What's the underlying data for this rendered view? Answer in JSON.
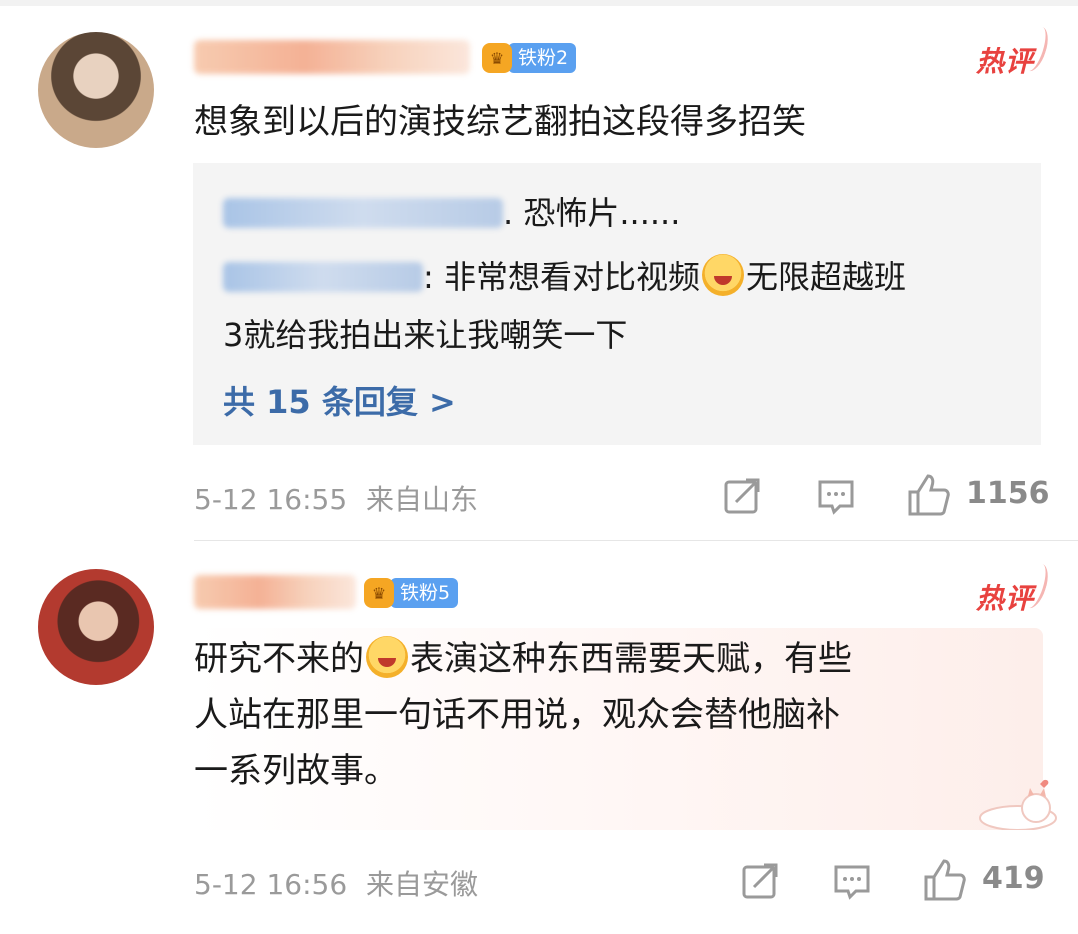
{
  "comments": [
    {
      "badge": "铁粉2",
      "hot_label": "热评",
      "text": "想象到以后的演技综艺翻拍这段得多招笑",
      "replies": [
        {
          "text": ". 恐怖片......"
        },
        {
          "text": ": 非常想看对比视频",
          "text2": "无限超越班",
          "text3": "3就给我拍出来让我嘲笑一下"
        }
      ],
      "more_replies": "共 15 条回复 >",
      "timestamp": "5-12 16:55",
      "location": "来自山东",
      "likes": "1156"
    },
    {
      "badge": "铁粉5",
      "hot_label": "热评",
      "text_line1a": "研究不来的",
      "text_line1b": "表演这种东西需要天赋，有些",
      "text_line2": "人站在那里一句话不用说，观众会替他脑补",
      "text_line3": "一系列故事。",
      "timestamp": "5-12 16:56",
      "location": "来自安徽",
      "likes": "419"
    }
  ],
  "colors": {
    "hot": "#e8423f",
    "badge": "#5aa0f0",
    "link": "#3c6ba8",
    "meta": "#9a9a9a"
  },
  "icons": [
    "share-icon",
    "comment-icon",
    "like-icon",
    "emoji-laugh-icon",
    "emoji-cry-laugh-icon",
    "crown-badge-icon",
    "cat-sticker-icon"
  ]
}
